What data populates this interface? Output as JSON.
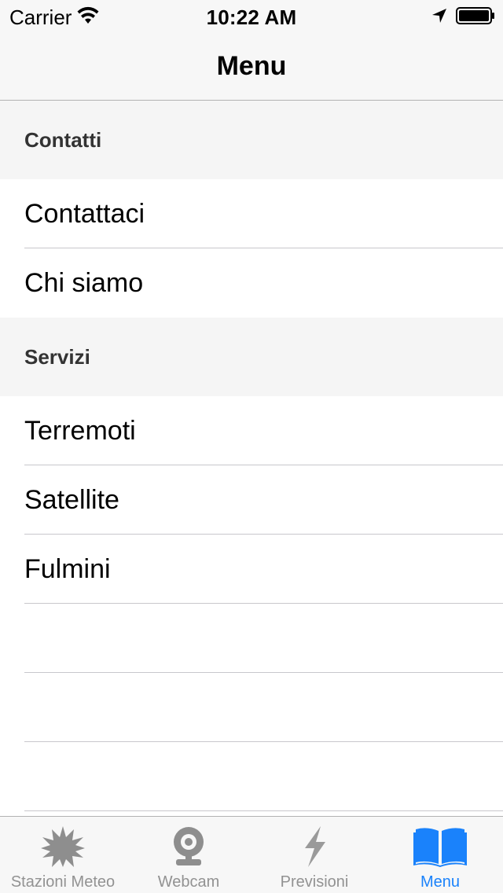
{
  "status_bar": {
    "carrier": "Carrier",
    "time": "10:22 AM",
    "wifi_icon": "wifi-icon",
    "location_icon": "location-arrow-icon",
    "battery_icon": "battery-full-icon"
  },
  "nav": {
    "title": "Menu"
  },
  "sections": [
    {
      "header": "Contatti",
      "rows": [
        "Contattaci",
        "Chi siamo"
      ]
    },
    {
      "header": "Servizi",
      "rows": [
        "Terremoti",
        "Satellite",
        "Fulmini"
      ]
    }
  ],
  "tabbar": {
    "tabs": [
      {
        "label": "Stazioni Meteo",
        "icon": "sun-burst-icon",
        "active": false
      },
      {
        "label": "Webcam",
        "icon": "webcam-icon",
        "active": false
      },
      {
        "label": "Previsioni",
        "icon": "lightning-icon",
        "active": false
      },
      {
        "label": "Menu",
        "icon": "open-book-icon",
        "active": true
      }
    ]
  },
  "colors": {
    "accent": "#1a82fb",
    "inactive_tab": "#929292",
    "section_bg": "#f5f5f5",
    "bar_bg": "#f7f7f7"
  }
}
